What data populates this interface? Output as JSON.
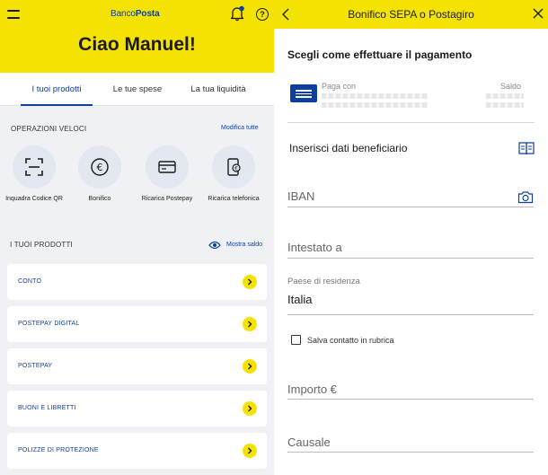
{
  "left": {
    "logo": {
      "part1": "Banco",
      "part2": "Posta"
    },
    "greeting": "Ciao Manuel!",
    "tabs": [
      {
        "label": "I tuoi prodotti"
      },
      {
        "label": "Le tue spese"
      },
      {
        "label": "La tua liquidità"
      }
    ],
    "quick_ops": {
      "title": "OPERAZIONI VELOCI",
      "edit_link": "Modifica tutte",
      "items": [
        {
          "label": "Inquadra Codice QR",
          "icon": "qr-scan-icon"
        },
        {
          "label": "Bonifico",
          "icon": "euro-icon"
        },
        {
          "label": "Ricarica Postepay",
          "icon": "card-icon"
        },
        {
          "label": "Ricarica telefonica",
          "icon": "phone-topup-icon"
        }
      ]
    },
    "products": {
      "title": "I TUOI PRODOTTI",
      "show_balance": "Mostra saldo",
      "items": [
        {
          "label": "CONTO"
        },
        {
          "label": "POSTEPAY DIGITAL"
        },
        {
          "label": "POSTEPAY"
        },
        {
          "label": "BUONI E LIBRETTI"
        },
        {
          "label": "POLIZZE DI PROTEZIONE"
        }
      ]
    }
  },
  "right": {
    "title": "Bonifico SEPA o Postagiro",
    "subtitle": "Scegli come effettuare il pagamento",
    "pay_with_label": "Paga con",
    "balance_label": "Saldo",
    "beneficiary_title": "Inserisci dati beneficiario",
    "iban_placeholder": "IBAN",
    "holder_placeholder": "Intestato a",
    "country_label": "Paese di residenza",
    "country_value": "Italia",
    "save_contact_label": "Salva contatto in rubrica",
    "amount_placeholder": "Importo €",
    "reason_placeholder": "Causale"
  },
  "colors": {
    "brand_yellow": "#f4e200",
    "brand_blue": "#0d3f9d"
  }
}
